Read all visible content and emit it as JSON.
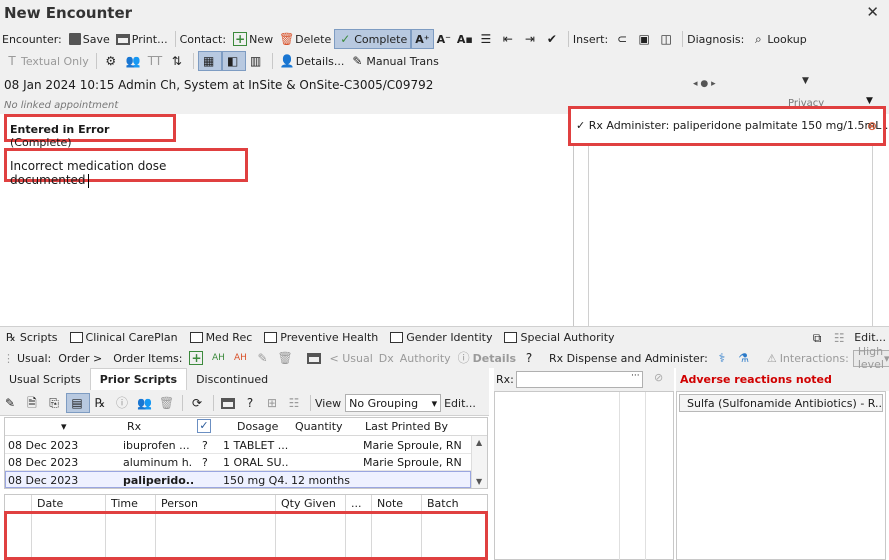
{
  "window": {
    "title": "New Encounter",
    "close_glyph": "✕"
  },
  "toolbar1": {
    "encounter_label": "Encounter:",
    "save": "Save",
    "print": "Print...",
    "contact_label": "Contact:",
    "new": "New",
    "delete": "Delete",
    "complete": "Complete",
    "insert_label": "Insert:",
    "diagnosis_label": "Diagnosis:",
    "lookup": "Lookup"
  },
  "toolbar2": {
    "textual_only": "Textual Only",
    "details": "Details...",
    "manual_trans": "Manual Trans"
  },
  "encounter_info": "08 Jan 2024 10:15 Admin Ch, System at InSite & OnSite-C3005/C09792",
  "no_linked": "No linked appointment",
  "privacy": "Privacy",
  "entered_in_error": {
    "bold": "Entered in Error",
    "status": "(Complete)"
  },
  "note_text": "Incorrect medication dose documented",
  "rx_administer": "Rx Administer: paliperidone palmitate 150 mg/1.5mL ...",
  "tabs": {
    "scripts": "Scripts",
    "clinical_careplan": "Clinical CarePlan",
    "med_rec": "Med Rec",
    "preventive_health": "Preventive Health",
    "gender_identity": "Gender Identity",
    "special_authority": "Special Authority",
    "edit": "Edit..."
  },
  "usualbar": {
    "usual_label": "Usual:",
    "order": "Order >",
    "order_items_label": "Order Items:",
    "usual_link": "< Usual",
    "dx": "Dx",
    "authority": "Authority",
    "details": "Details",
    "rx_dispense": "Rx Dispense and Administer:",
    "interactions_label": "Interactions:",
    "interactions_value": "High level"
  },
  "subtabs": [
    "Usual Scripts",
    "Prior Scripts",
    "Discontinued"
  ],
  "rx_toolbar": {
    "view_label": "View",
    "view_value": "No Grouping",
    "edit": "Edit..."
  },
  "rx_grid": {
    "headers": {
      "rx": "Rx",
      "dosage": "Dosage",
      "quantity": "Quantity",
      "last_printed": "Last Printed By"
    },
    "rows": [
      {
        "date": "08 Dec 2023",
        "rx": "ibuprofen ...",
        "flag": "?",
        "dosage": "1 TABLET ...",
        "quantity": "",
        "last_printed": "Marie Sproule, RN"
      },
      {
        "date": "08 Dec 2023",
        "rx": "aluminum h...",
        "flag": "?",
        "dosage": "1 ORAL SU...",
        "quantity": "",
        "last_printed": "Marie Sproule, RN"
      },
      {
        "date": "08 Dec 2023",
        "rx": "paliperido...",
        "flag": "",
        "dosage": "150 mg Q4...",
        "quantity": "12 months",
        "last_printed": ""
      }
    ]
  },
  "admin_grid": {
    "headers": [
      "Date",
      "Time",
      "Person",
      "Qty Given",
      "...",
      "Note",
      "Batch"
    ]
  },
  "rx_search": {
    "label": "Rx:",
    "value": "",
    "more": "···"
  },
  "adverse": {
    "title": "Adverse reactions noted",
    "item": "Sulfa (Sulfonamide Antibiotics) - R..."
  }
}
